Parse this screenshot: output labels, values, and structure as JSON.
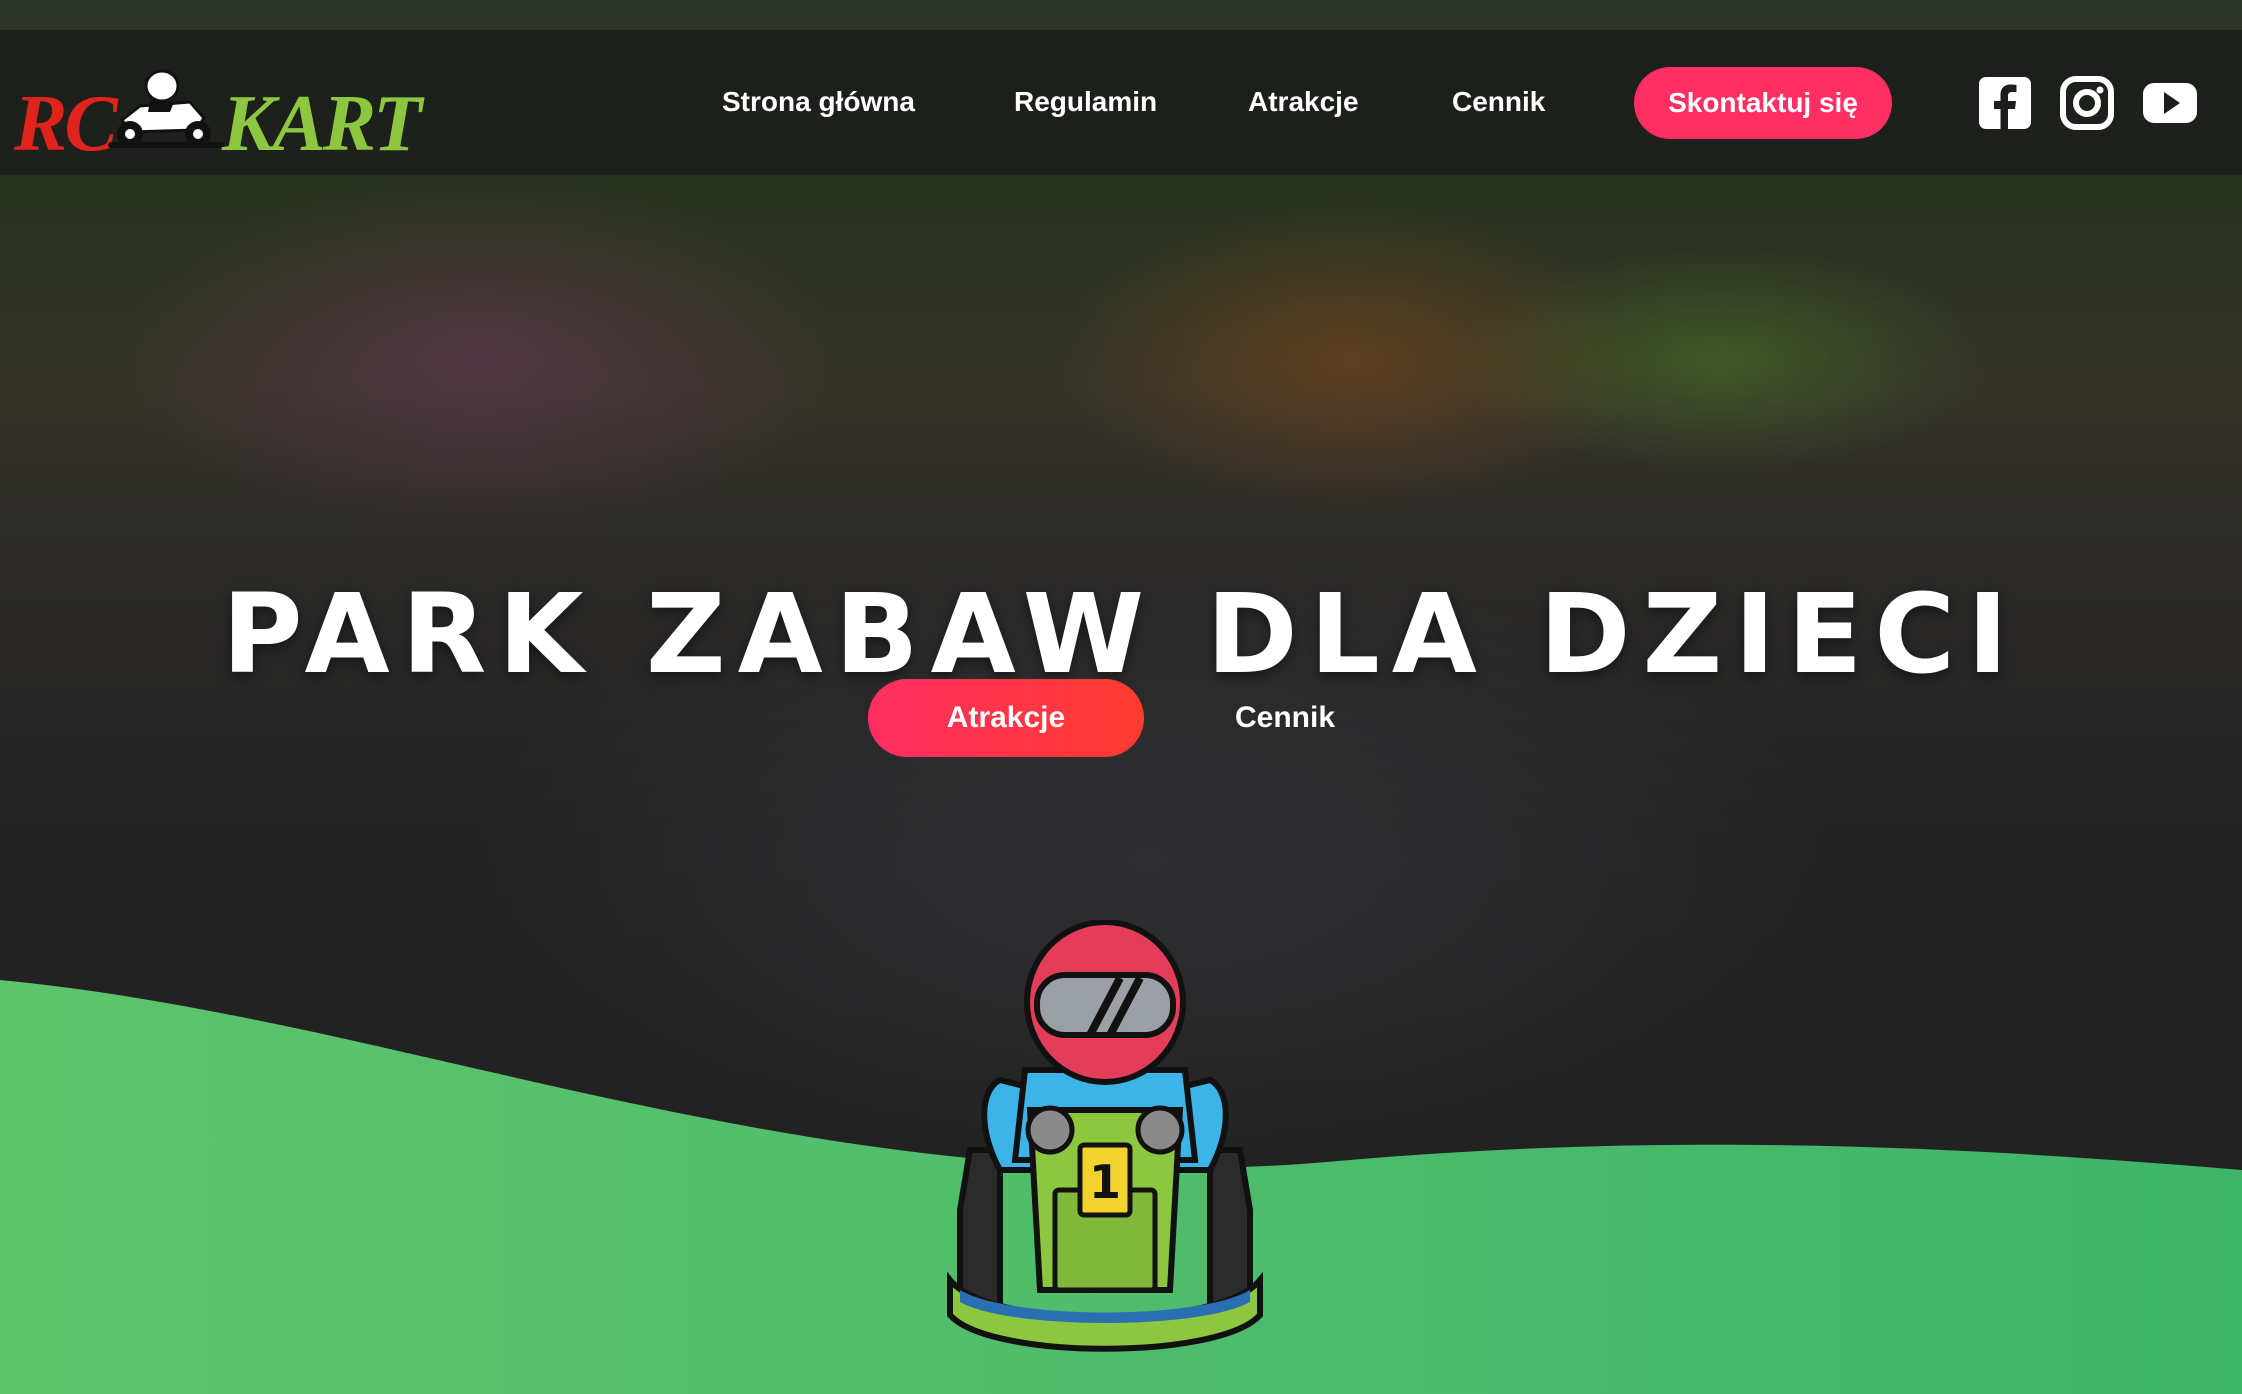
{
  "logo": {
    "rc": "RC",
    "kart": "KART"
  },
  "nav": {
    "items": [
      {
        "label": "Strona główna"
      },
      {
        "label": "Regulamin"
      },
      {
        "label": "Atrakcje"
      },
      {
        "label": "Cennik"
      }
    ],
    "contact_label": "Skontaktuj się"
  },
  "social": [
    "facebook-icon",
    "instagram-icon",
    "youtube-icon"
  ],
  "hero": {
    "title": "PARK ZABAW DLA DZIECI",
    "primary_button": "Atrakcje",
    "secondary_link": "Cennik"
  },
  "mascot": {
    "kart_number": "1"
  },
  "colors": {
    "accent": "#ff2e63",
    "green": "#5ec46c",
    "logo_red": "#e0241b",
    "logo_green": "#8dc63f"
  }
}
